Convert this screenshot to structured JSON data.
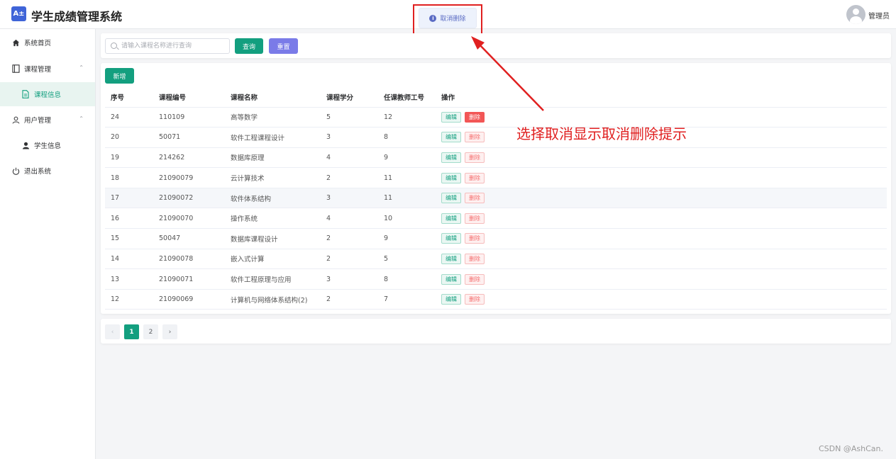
{
  "header": {
    "logo_text": "A±",
    "title": "学生成绩管理系统",
    "user_name": "管理员"
  },
  "message": {
    "text": "取消删除",
    "icon": "info-icon"
  },
  "sidebar": {
    "items": [
      {
        "label": "系统首页",
        "icon": "home-icon"
      },
      {
        "label": "课程管理",
        "icon": "book-icon",
        "arrow": "⌃"
      },
      {
        "label": "课程信息",
        "icon": "document-icon"
      },
      {
        "label": "用户管理",
        "icon": "user-icon",
        "arrow": "⌃"
      },
      {
        "label": "学生信息",
        "icon": "person-icon"
      },
      {
        "label": "退出系统",
        "icon": "power-icon"
      }
    ]
  },
  "search": {
    "placeholder": "请输入课程名称进行查询",
    "query_label": "查询",
    "reset_label": "重置"
  },
  "toolbar": {
    "add_label": "新增"
  },
  "table": {
    "columns": [
      "序号",
      "课程编号",
      "课程名称",
      "课程学分",
      "任课教师工号",
      "操作"
    ],
    "edit_label": "编辑",
    "delete_label": "删除",
    "rows": [
      [
        "24",
        "110109",
        "高等数学",
        "5",
        "12"
      ],
      [
        "20",
        "50071",
        "软件工程课程设计",
        "3",
        "8"
      ],
      [
        "19",
        "214262",
        "数据库原理",
        "4",
        "9"
      ],
      [
        "18",
        "21090079",
        "云计算技术",
        "2",
        "11"
      ],
      [
        "17",
        "21090072",
        "软件体系结构",
        "3",
        "11"
      ],
      [
        "16",
        "21090070",
        "操作系统",
        "4",
        "10"
      ],
      [
        "15",
        "50047",
        "数据库课程设计",
        "2",
        "9"
      ],
      [
        "14",
        "21090078",
        "嵌入式计算",
        "2",
        "5"
      ],
      [
        "13",
        "21090071",
        "软件工程原理与应用",
        "3",
        "8"
      ],
      [
        "12",
        "21090069",
        "计算机与网络体系结构(2)",
        "2",
        "7"
      ]
    ]
  },
  "pagination": {
    "prev": "‹",
    "pages": [
      "1",
      "2"
    ],
    "current": "1",
    "next": "›"
  },
  "annotation": {
    "text": "选择取消显示取消删除提示"
  },
  "watermark": "CSDN @AshCan.",
  "colors": {
    "accent": "#139f7f",
    "reset": "#7a7be8",
    "danger": "#f25656",
    "annotation": "#e02020",
    "logo": "#3f64d8"
  }
}
